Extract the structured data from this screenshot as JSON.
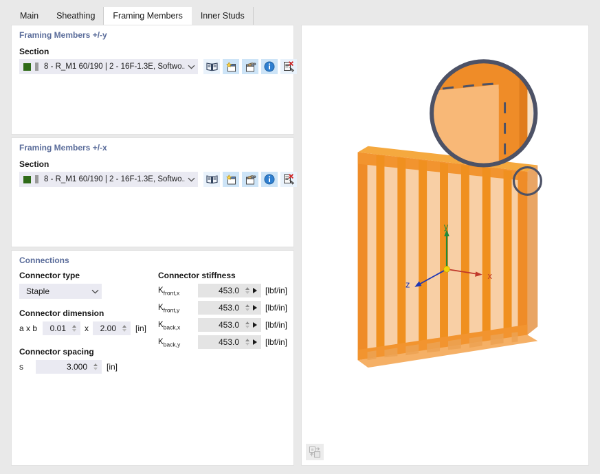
{
  "tabs": [
    {
      "label": "Main",
      "active": false
    },
    {
      "label": "Sheathing",
      "active": false
    },
    {
      "label": "Framing Members",
      "active": true
    },
    {
      "label": "Inner Studs",
      "active": false
    }
  ],
  "panels": {
    "framing_y": {
      "legend": "Framing Members +/-y",
      "section_label": "Section",
      "section_value": "8 - R_M1 60/190 | 2 - 16F-1.3E, Softwo...",
      "toolbar": [
        {
          "name": "library-book-icon",
          "title": "Library"
        },
        {
          "name": "new-section-icon",
          "title": "New"
        },
        {
          "name": "edit-section-icon",
          "title": "Edit"
        },
        {
          "name": "info-icon",
          "title": "Info"
        },
        {
          "name": "delete-section-icon",
          "title": "Delete"
        }
      ]
    },
    "framing_x": {
      "legend": "Framing Members +/-x",
      "section_label": "Section",
      "section_value": "8 - R_M1 60/190 | 2 - 16F-1.3E, Softwo...",
      "toolbar": [
        {
          "name": "library-book-icon",
          "title": "Library"
        },
        {
          "name": "new-section-icon",
          "title": "New"
        },
        {
          "name": "edit-section-icon",
          "title": "Edit"
        },
        {
          "name": "info-icon",
          "title": "Info"
        },
        {
          "name": "delete-section-icon",
          "title": "Delete"
        }
      ]
    },
    "connections": {
      "legend": "Connections",
      "connector_type_label": "Connector type",
      "connector_type_value": "Staple",
      "connector_dimension_label": "Connector dimension",
      "dim_prefix": "a x b",
      "dim_a": "0.01",
      "dim_sep": "x",
      "dim_b": "2.00",
      "dim_unit": "[in]",
      "connector_spacing_label": "Connector spacing",
      "spacing_symbol": "s",
      "spacing_value": "3.000",
      "spacing_unit": "[in]",
      "stiffness_label": "Connector stiffness",
      "stiffness_rows": [
        {
          "sym": "K",
          "sub": "front,x",
          "value": "453.0",
          "unit": "[lbf/in]"
        },
        {
          "sym": "K",
          "sub": "front,y",
          "value": "453.0",
          "unit": "[lbf/in]"
        },
        {
          "sym": "K",
          "sub": "back,x",
          "value": "453.0",
          "unit": "[lbf/in]"
        },
        {
          "sym": "K",
          "sub": "back,y",
          "value": "453.0",
          "unit": "[lbf/in]"
        }
      ]
    }
  },
  "viewport": {
    "axis_x": "x",
    "axis_y": "y",
    "axis_z": "z",
    "axis_x_color": "#c0392b",
    "axis_y_color": "#1f8a3c",
    "axis_z_color": "#1f37b4",
    "origin_color": "#f2d10a",
    "frame_color": "#f08a28",
    "panel_color": "#f7cfa4",
    "detail_ring_color": "#4d5266",
    "render_icon": "render-mode-icon"
  }
}
